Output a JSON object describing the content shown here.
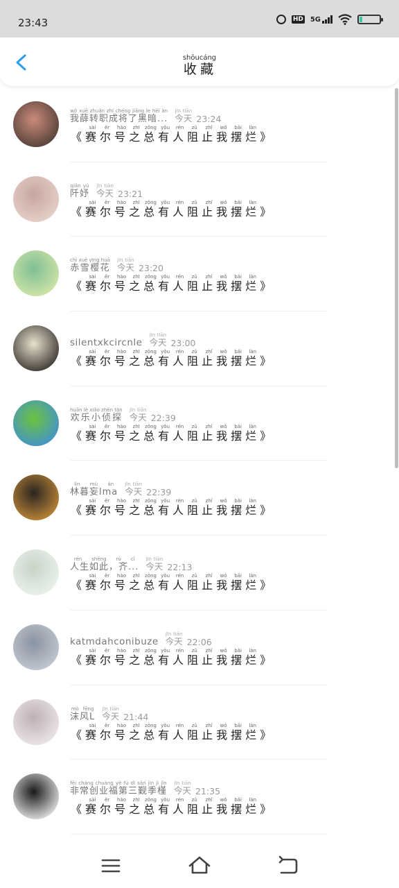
{
  "status": {
    "time": "23:43",
    "hd": "HD",
    "network": "5G",
    "battery_level": 0.12
  },
  "header": {
    "title_chars": [
      {
        "ch": "收",
        "py": ""
      },
      {
        "ch": "藏",
        "py": ""
      }
    ],
    "title_pinyin": "shōucáng"
  },
  "message_text": [
    {
      "ch": "《",
      "py": ""
    },
    {
      "ch": "赛",
      "py": "sài"
    },
    {
      "ch": "尔",
      "py": "ěr"
    },
    {
      "ch": "号",
      "py": "hào"
    },
    {
      "ch": "之",
      "py": "zhī"
    },
    {
      "ch": "总",
      "py": "zǒng"
    },
    {
      "ch": "有",
      "py": "yǒu"
    },
    {
      "ch": "人",
      "py": "rén"
    },
    {
      "ch": "阻",
      "py": "zǔ"
    },
    {
      "ch": "止",
      "py": "zhǐ"
    },
    {
      "ch": "我",
      "py": "wǒ"
    },
    {
      "ch": "摆",
      "py": "bǎi"
    },
    {
      "ch": "烂",
      "py": "làn"
    },
    {
      "ch": "》",
      "py": ""
    }
  ],
  "day_label": {
    "ch": "今天",
    "py": "jīn tiān"
  },
  "items": [
    {
      "name": "我薛转职成将了黑暗...",
      "name_py": "wǒ xuē zhuǎn zhí chéng jiāng le hēi àn",
      "time": "23:24"
    },
    {
      "name": "阡妤",
      "name_py": "qiān yú",
      "time": "23:21"
    },
    {
      "name": "赤雪樱花",
      "name_py": "chì xuě yīng huā",
      "time": "23:20"
    },
    {
      "name": "silentxkcircnle",
      "name_py": "",
      "time": "23:00"
    },
    {
      "name": "欢乐小侦探",
      "name_py": "huān lè xiǎo zhēn tàn",
      "time": "22:39"
    },
    {
      "name": "林暮妄lma",
      "name_py": "lín mù ǎn",
      "time": "22:39"
    },
    {
      "name": "人生如此，齐...",
      "name_py": "rén shēng rú cǐ",
      "time": "22:13"
    },
    {
      "name": "katmdahconibuze",
      "name_py": "",
      "time": "22:06"
    },
    {
      "name": "沫风L",
      "name_py": "mò fēng",
      "time": "21:44"
    },
    {
      "name": "非常创业福第三觐季槿",
      "name_py": "fēi cháng chuàng yè fú dì sān jìn jì jǐn",
      "time": "21:35"
    }
  ],
  "avatar_colors": [
    [
      "#4a3a34",
      "#c98b7a"
    ],
    [
      "#e9d3cc",
      "#c6a6a0"
    ],
    [
      "#d7e7a8",
      "#7fbf95"
    ],
    [
      "#2d2a25",
      "#e8e1cf"
    ],
    [
      "#3f8fd8",
      "#6cc23c"
    ],
    [
      "#c98f3a",
      "#2b2520"
    ],
    [
      "#eef4ee",
      "#c9d2c9"
    ],
    [
      "#c7ccd4",
      "#8a93a0"
    ],
    [
      "#efe9ea",
      "#bdb0b4"
    ],
    [
      "#f2f2f2",
      "#1a1a1a"
    ]
  ]
}
